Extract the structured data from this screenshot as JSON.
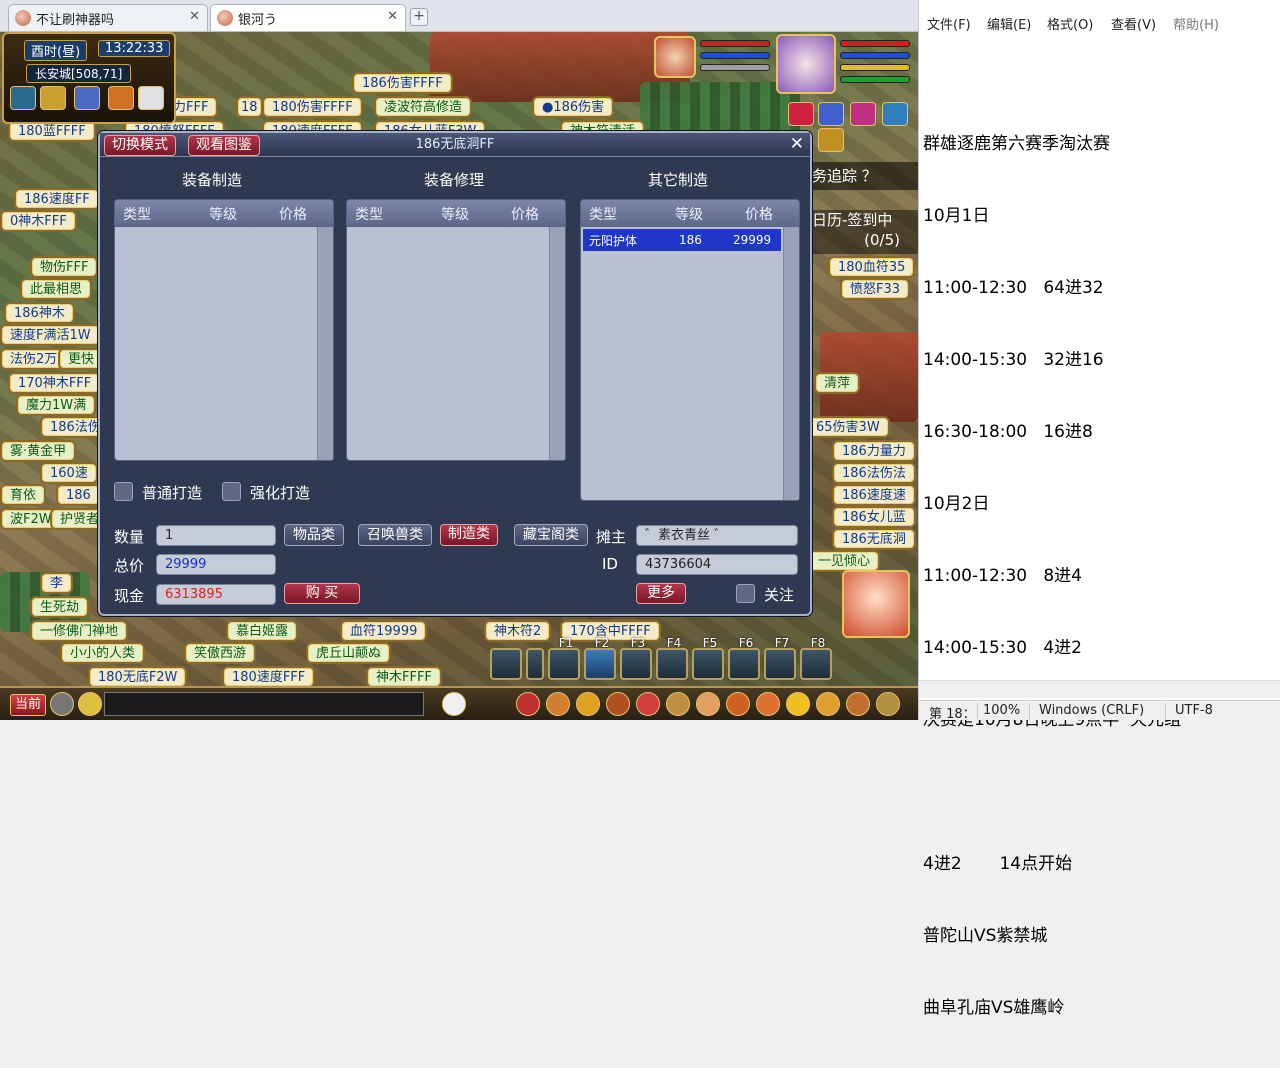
{
  "browser": {
    "tabs": [
      {
        "title": "不让刷神器吗",
        "close": "✕"
      },
      {
        "title": "银河う",
        "close": "✕"
      }
    ],
    "new_tab": "+"
  },
  "game": {
    "hud": {
      "shichen": "酉时(昼)",
      "clock": "13:22:33",
      "location": "长安城[508,71]"
    },
    "quest_tracker": "务追踪 ？",
    "daily": "日历-签到中",
    "daily_count": "(0/5)",
    "stalls": [
      "186伤害FFFF",
      "魔力FFF",
      "180伤害FFFF",
      "凌波符高修造",
      "●186伤害",
      "18",
      "180蓝FFFF",
      "180愤怒FFFF",
      "180速度FFFF",
      "186女儿蓝F3W",
      "神木符清活",
      "186速度FF",
      "0神木FFF",
      "物伤FFF",
      "此最相思",
      "186神木",
      "速度F满活1W",
      "法伤2万",
      "更快",
      "170神木FFF",
      "魔力1W满",
      "186法伤",
      "雾·黄金甲",
      "160速",
      "育依",
      "186",
      "波F2W",
      "护贤者",
      "生死劫",
      "李",
      "180血符35",
      "愤怒F33",
      "清萍",
      "65伤害3W",
      "186力量力",
      "186法伤法",
      "186速度速",
      "186女儿蓝",
      "186无底洞",
      "一见倾心",
      "一修佛门禅地",
      "慕白姬露",
      "血符19999",
      "神木符2",
      "170含中FFFF",
      "小小的人类",
      "笑傲西游",
      "虎丘山颠ぬ",
      "180无底F2W",
      "180速度FFF",
      "神木FFFF"
    ],
    "fkeys": [
      "F1",
      "F2",
      "F3",
      "F4",
      "F5",
      "F6",
      "F7",
      "F8"
    ],
    "bottom": {
      "current_channel": "当前"
    }
  },
  "dialog": {
    "title": "186无底洞FF",
    "switch_mode": "切换模式",
    "view_gallery": "观看图鉴",
    "close": "✕",
    "sections": [
      {
        "title": "装备制造",
        "headers": [
          "类型",
          "等级",
          "价格"
        ],
        "rows": []
      },
      {
        "title": "装备修理",
        "headers": [
          "类型",
          "等级",
          "价格"
        ],
        "rows": []
      },
      {
        "title": "其它制造",
        "headers": [
          "类型",
          "等级",
          "价格"
        ],
        "rows": [
          {
            "type": "元阳护体",
            "level": "186",
            "price": "29999"
          }
        ]
      }
    ],
    "normal_forge": "普通打造",
    "strong_forge": "强化打造",
    "quantity_label": "数量",
    "quantity_value": "1",
    "total_label": "总价",
    "total_value": "29999",
    "cash_label": "现金",
    "cash_value": "6313895",
    "buy": "购 买",
    "cat_items": "物品类",
    "cat_pets": "召唤兽类",
    "cat_make": "制造类",
    "cat_treasure": "藏宝阁类",
    "owner_label": "摊主",
    "owner_value": "゛素衣青丝 ゛",
    "id_label": "ID",
    "id_value": "43736604",
    "more": "更多",
    "follow": "关注"
  },
  "notepad": {
    "menu": [
      "文件(F)",
      "编辑(E)",
      "格式(O)",
      "查看(V)",
      "帮助(H)"
    ],
    "lines": [
      "群雄逐鹿第六赛季淘汰赛",
      "10月1日",
      "11:00-12:30   64进32",
      "14:00-15:30   32进16",
      "16:30-18:00   16进8",
      "10月2日",
      "11:00-12:30   8进4",
      "14:00-15:30   4进2",
      "决赛是10月8日晚上9点半  天元组",
      "",
      "4进2       14点开始",
      "普陀山VS紫禁城",
      "曲阜孔庙VS雄鹰岭"
    ],
    "status": {
      "position": "第 18：",
      "zoom": "100%",
      "eol": "Windows (CRLF)",
      "encoding": "UTF-8"
    }
  }
}
